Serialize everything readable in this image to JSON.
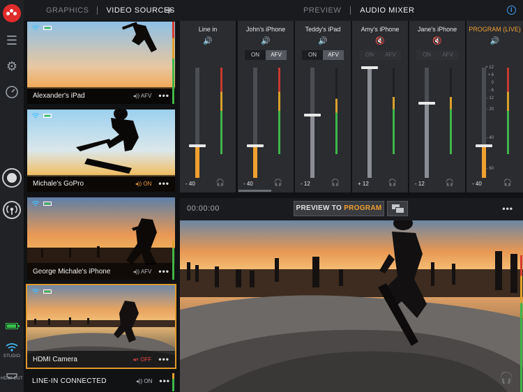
{
  "source_tabs": {
    "graphics": "GRAPHICS",
    "video_sources": "VIDEO SOURCES",
    "add": "+"
  },
  "mixer_tabs": {
    "preview": "PREVIEW",
    "audio_mixer": "AUDIO MIXER",
    "info": "i"
  },
  "rail": {
    "studio_label": "STUDIO",
    "hdmi_label": "HDMI OUT"
  },
  "sources": [
    {
      "name": "Alexander's iPad",
      "audio": "AFV",
      "audio_state": "afv"
    },
    {
      "name": "Michale's GoPro",
      "audio": "ON",
      "audio_state": "on"
    },
    {
      "name": "George Michale's iPhone",
      "audio": "AFV",
      "audio_state": "afv"
    },
    {
      "name": "HDMI Camera",
      "audio": "OFF",
      "audio_state": "off",
      "selected": true
    }
  ],
  "line_in_source": {
    "name": "LINE-IN CONNECTED",
    "audio": "ON"
  },
  "more_label": "•••",
  "channels": [
    {
      "title": "Line in",
      "level": "- 40",
      "level_fraction": 0.29,
      "on": "",
      "afv": ""
    },
    {
      "title": "John's iPhone",
      "level": "- 40",
      "level_fraction": 0.29,
      "on": "ON",
      "afv": "AFV"
    },
    {
      "title": "Teddy's iPad",
      "level": "- 12",
      "level_fraction": 0.57,
      "on": "ON",
      "afv": "AFV"
    },
    {
      "title": "Amy's  iPhone",
      "level": "+ 12",
      "level_fraction": 1.0,
      "on": "ON",
      "afv": "AFV"
    },
    {
      "title": "Jane's  iPhone",
      "level": "- 12",
      "level_fraction": 0.68,
      "on": "ON",
      "afv": "AFV"
    },
    {
      "title": "PROGRAM (LIVE)",
      "level": "- 40",
      "level_fraction": 0.29,
      "on": "",
      "afv": ""
    }
  ],
  "program_scale": [
    "+ 12",
    "+ 6",
    "0",
    "- 6",
    "- 12",
    "- 20",
    "- 40",
    "- 60"
  ],
  "preview_bar": {
    "timecode": "00:00:00",
    "preview_to": "PREVIEW TO",
    "program": "PROGRAM"
  },
  "colors": {
    "accent": "#f0a030",
    "muted": "#e94848",
    "wifi": "#45c2ff",
    "battery": "#35c14a"
  }
}
